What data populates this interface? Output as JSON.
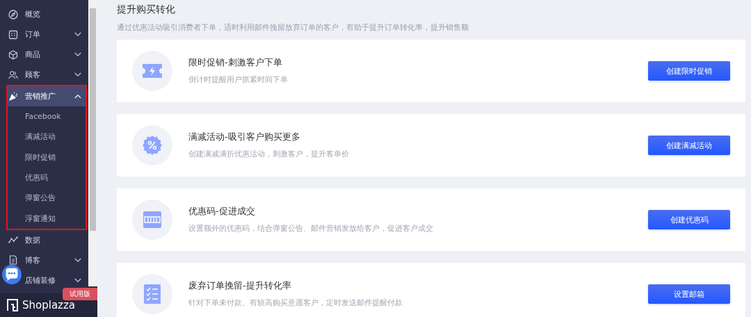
{
  "sidebar": {
    "items": [
      {
        "label": "概览",
        "expandable": false,
        "selected": false
      },
      {
        "label": "订单",
        "expandable": true,
        "expanded": false,
        "selected": false
      },
      {
        "label": "商品",
        "expandable": true,
        "expanded": false,
        "selected": false
      },
      {
        "label": "顾客",
        "expandable": true,
        "expanded": false,
        "selected": false
      },
      {
        "label": "营销推广",
        "expandable": true,
        "expanded": true,
        "selected": true,
        "children": [
          {
            "label": "Facebook"
          },
          {
            "label": "满减活动"
          },
          {
            "label": "限时促销"
          },
          {
            "label": "优惠码"
          },
          {
            "label": "弹窗公告"
          },
          {
            "label": "浮窗通知"
          }
        ]
      },
      {
        "label": "数据",
        "expandable": false,
        "selected": false
      },
      {
        "label": "博客",
        "expandable": true,
        "expanded": false,
        "selected": false
      },
      {
        "label": "店铺装修",
        "expandable": true,
        "expanded": false,
        "selected": false
      }
    ],
    "badge": "试用版",
    "logo": "Shoplazza"
  },
  "section": {
    "title": "提升购买转化",
    "subtitle": "通过优惠活动吸引消费者下单，适时利用邮件挽留放弃订单的客户，有助于提升订单转化率，提升销售额"
  },
  "cards": [
    {
      "title": "限时促销-刺激客户下单",
      "description": "倒计时提醒用户抓紧时间下单",
      "button": "创建限时促销"
    },
    {
      "title": "满减活动-吸引客户购买更多",
      "description": "创建满减满折优惠活动，刺激客户，提升客单价",
      "button": "创建满减活动"
    },
    {
      "title": "优惠码-促进成交",
      "description": "设置额外的优惠码，结合弹窗公告、邮件营销发放给客户，促进客户成交",
      "button": "创建优惠码"
    },
    {
      "title": "废弃订单挽留-提升转化率",
      "description": "针对下单未付款、有较高购买意愿客户，定时发送邮件提醒付款",
      "button": "设置邮箱"
    }
  ]
}
